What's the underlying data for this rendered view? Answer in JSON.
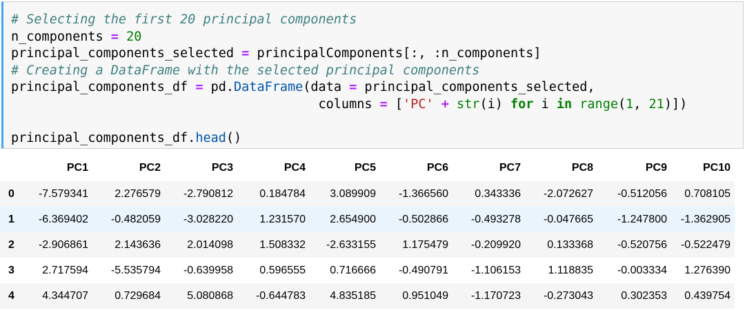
{
  "code": {
    "line1": "# Selecting the first 20 principal components",
    "line2_var": "n_components",
    "line2_eq": "=",
    "line2_num": "20",
    "line3_var": "principal_components_selected",
    "line3_eq": "=",
    "line3_expr": "principalComponents[:, :n_components]",
    "line4": "# Creating a DataFrame with the selected principal components",
    "line5_var": "principal_components_df",
    "line5_eq": "=",
    "line5_mod": "pd.",
    "line5_fn": "DataFrame",
    "line5_open": "(data ",
    "line5_eq2": "=",
    "line5_rest": " principal_components_selected,",
    "line6_indent": "                                        columns ",
    "line6_eq": "=",
    "line6_br": " [",
    "line6_str": "'PC'",
    "line6_plus": "+",
    "line6_str_fn": "str",
    "line6_i": "(i) ",
    "line6_for": "for",
    "line6_i2": " i ",
    "line6_in": "in",
    "line6_range": "range",
    "line6_paren": "(",
    "line6_n1": "1",
    "line6_comma": ", ",
    "line6_n2": "21",
    "line6_close": ")])",
    "line8_var": "principal_components_df.",
    "line8_fn": "head",
    "line8_close": "()"
  },
  "table": {
    "columns": [
      "PC1",
      "PC2",
      "PC3",
      "PC4",
      "PC5",
      "PC6",
      "PC7",
      "PC8",
      "PC9",
      "PC10"
    ],
    "rows": [
      {
        "index": "0",
        "values": [
          "-7.579341",
          "2.276579",
          "-2.790812",
          "0.184784",
          "3.089909",
          "-1.366560",
          "0.343336",
          "-2.072627",
          "-0.512056",
          "0.708105"
        ]
      },
      {
        "index": "1",
        "values": [
          "-6.369402",
          "-0.482059",
          "-3.028220",
          "1.231570",
          "2.654900",
          "-0.502866",
          "-0.493278",
          "-0.047665",
          "-1.247800",
          "-1.362905"
        ]
      },
      {
        "index": "2",
        "values": [
          "-2.906861",
          "2.143636",
          "2.014098",
          "1.508332",
          "-2.633155",
          "1.175479",
          "-0.209920",
          "0.133368",
          "-0.520756",
          "-0.522479"
        ]
      },
      {
        "index": "3",
        "values": [
          "2.717594",
          "-5.535794",
          "-0.639958",
          "0.596555",
          "0.716666",
          "-0.490791",
          "-1.106153",
          "1.118835",
          "-0.003334",
          "1.276390"
        ]
      },
      {
        "index": "4",
        "values": [
          "4.344707",
          "0.729684",
          "5.080868",
          "-0.644783",
          "4.835185",
          "0.951049",
          "-1.170723",
          "-0.273043",
          "0.302353",
          "0.439754"
        ]
      }
    ]
  },
  "colors": {
    "comment": "#408080",
    "operator": "#aa22ff",
    "number": "#008000",
    "string": "#ba2121",
    "function": "#0055aa",
    "cell_border_active": "#42a5f5",
    "row_hover": "#e9f4fd"
  }
}
